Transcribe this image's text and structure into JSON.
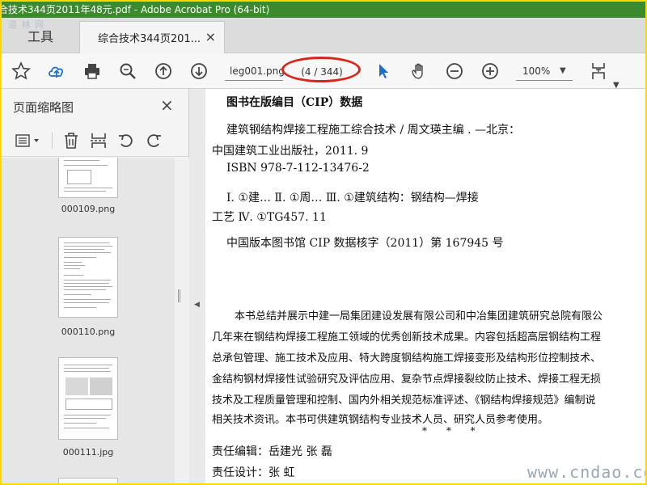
{
  "window": {
    "title": "合技术344页2011年48元.pdf - Adobe Acrobat Pro (64-bit)"
  },
  "tabs": {
    "tools_label": "工具",
    "document_tab_label": "综合技术344页201...",
    "close_glyph": "×",
    "watermark": "道 林 网"
  },
  "toolbar": {
    "icons": [
      "star-icon",
      "upload-cloud-icon",
      "print-icon",
      "zoom-search-icon",
      "page-up-icon",
      "page-down-icon",
      "select-cursor-icon",
      "hand-icon",
      "zoom-out-icon",
      "zoom-in-icon",
      "fit-page-icon"
    ],
    "filename_value": "leg001.png",
    "page_count": "(4 / 344)",
    "zoom_value": "100%",
    "highlight_color": "#d8261c"
  },
  "left_panel": {
    "title": "页面缩略图",
    "close_glyph": "×",
    "thumbnails": [
      {
        "label": "000109.png"
      },
      {
        "label": "000110.png"
      },
      {
        "label": "000111.jpg"
      }
    ]
  },
  "document": {
    "heading": "图书在版编目（CIP）数据",
    "lines": [
      "建筑钢结构焊接工程施工综合技术 / 周文瑛主编 . —北京：",
      "中国建筑工业出版社，2011. 9",
      "ISBN 978-7-112-13476-2",
      "Ⅰ. ①建…   Ⅱ. ①周…   Ⅲ. ①建筑结构：钢结构—焊接",
      "工艺   Ⅳ. ①TG457. 11",
      "中国版本图书馆 CIP 数据核字（2011）第 167945 号"
    ],
    "summary": [
      "本书总结并展示中建一局集团建设发展有限公司和中冶集团建筑研究总院有限公",
      "几年来在钢结构焊接工程施工领域的优秀创新技术成果。内容包括超高层钢结构工程",
      "总承包管理、施工技术及应用、特大跨度钢结构施工焊接变形及结构形位控制技术、",
      "金结构钢材焊接性试验研究及评估应用、复杂节点焊接裂纹防止技术、焊接工程无损",
      "技术及工程质量管理和控制、国内外相关规范标准评述、《钢结构焊接规范》编制说",
      "相关技术资讯。本书可供建筑钢结构专业技术人员、研究人员参考使用。"
    ],
    "separator": "* * *",
    "editor_line": "责任编辑：岳建光   张   磊",
    "designer_line": "责任设计：张   虹",
    "watermark": "www.cndao.com"
  },
  "colors": {
    "title_bar": "#3c8a2e",
    "outer_frame": "#ffd800",
    "accent_blue": "#1f6fc6"
  }
}
